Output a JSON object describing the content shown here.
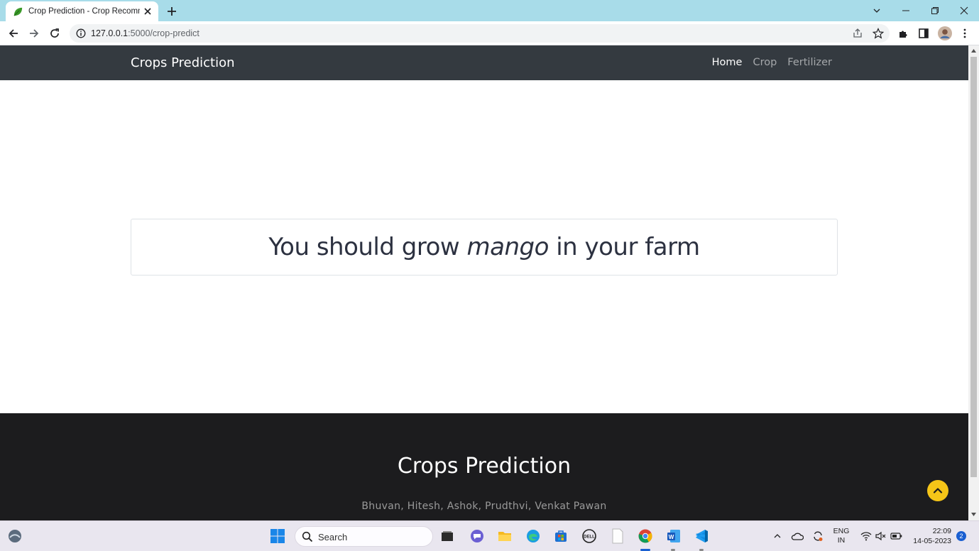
{
  "browser": {
    "tab_title": "Crop Prediction - Crop Recomme",
    "url_host": "127.0.0.1",
    "url_path": ":5000/crop-predict"
  },
  "navbar": {
    "brand": "Crops Prediction",
    "links": [
      {
        "label": "Home",
        "active": true
      },
      {
        "label": "Crop",
        "active": false
      },
      {
        "label": "Fertilizer",
        "active": false
      }
    ]
  },
  "result": {
    "prefix": "You should grow ",
    "crop": "mango",
    "suffix": " in your farm"
  },
  "footer": {
    "title": "Crops Prediction",
    "names": "Bhuvan, Hitesh, Ashok, Prudthvi, Venkat Pawan"
  },
  "taskbar": {
    "search_label": "Search",
    "lang_line1": "ENG",
    "lang_line2": "IN",
    "time": "22:09",
    "date": "14-05-2023",
    "notification_count": "2"
  },
  "colors": {
    "navbar_bg": "#343a40",
    "footer_bg": "#1c1c1e",
    "to_top": "#f5c518",
    "tabstrip": "#a8dce9"
  }
}
